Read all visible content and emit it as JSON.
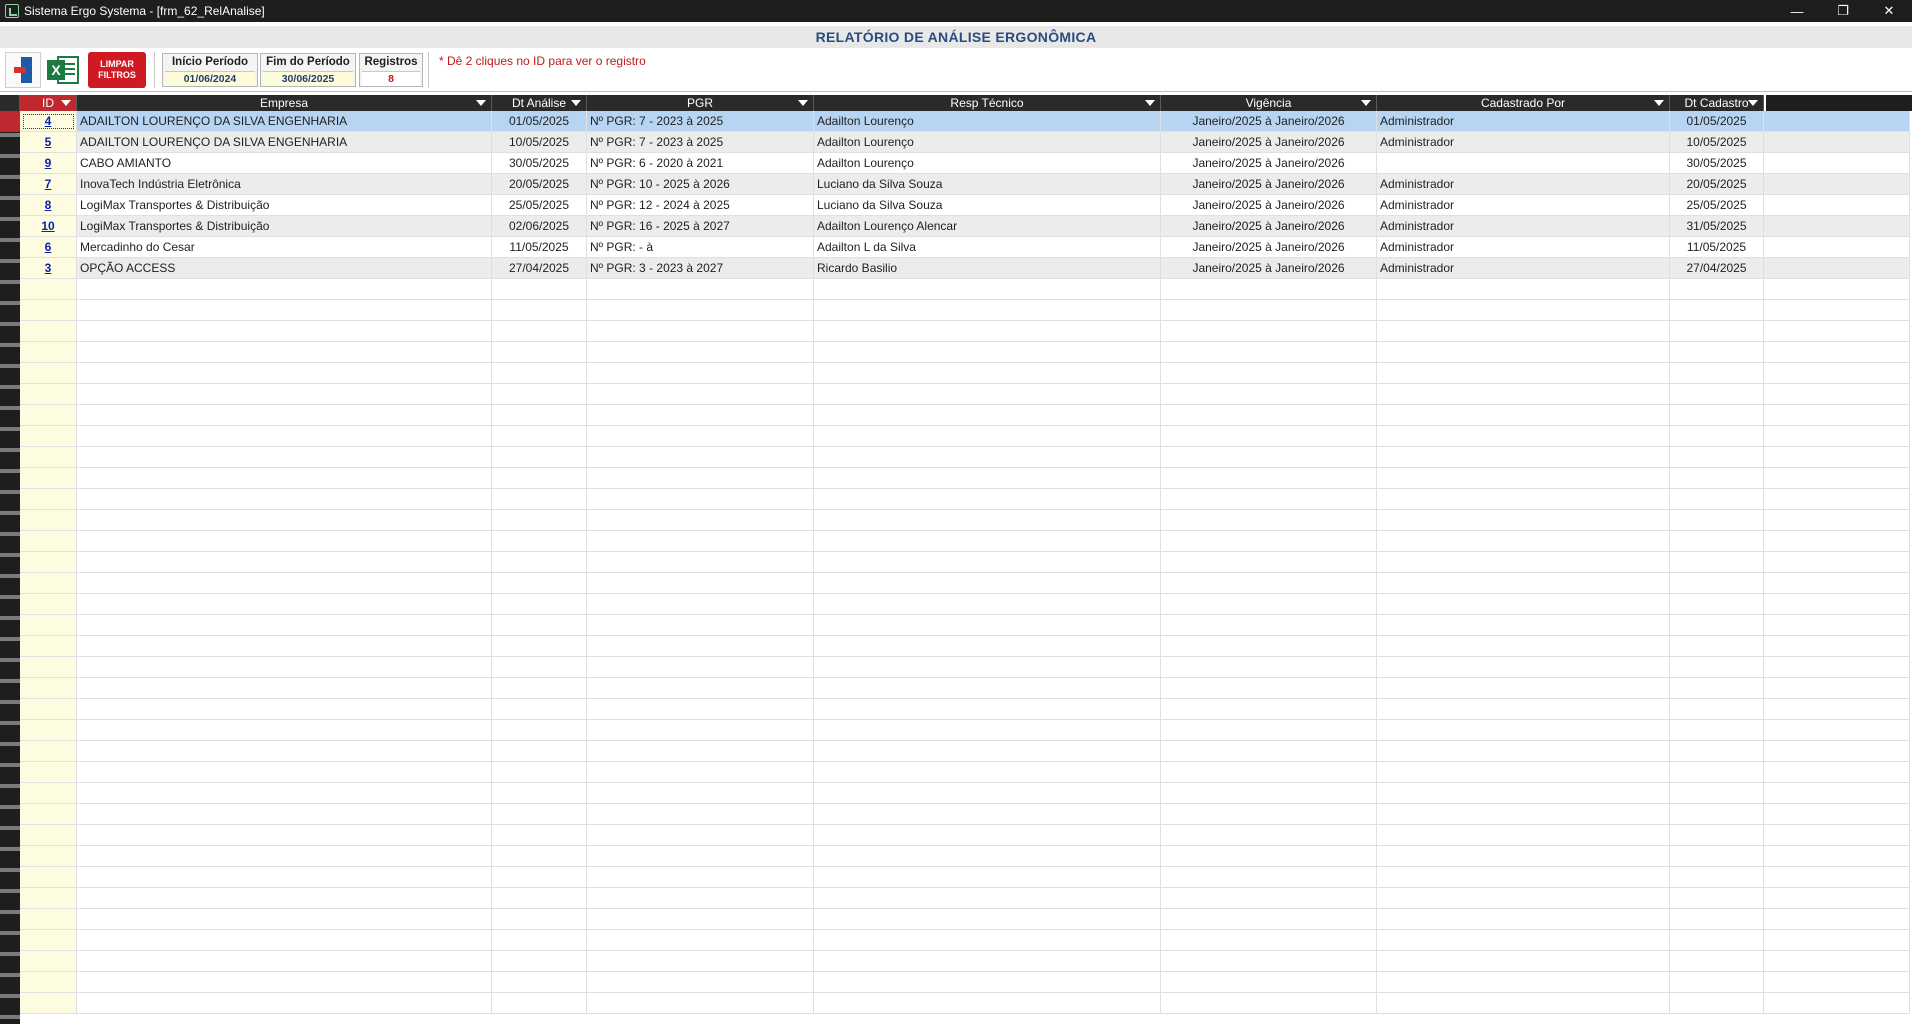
{
  "window": {
    "title": "Sistema Ergo Systema - [frm_62_RelAnalise]",
    "minimize": "—",
    "restore": "❐",
    "close": "✕"
  },
  "form": {
    "title": "RELATÓRIO DE ANÁLISE ERGONÔMICA"
  },
  "toolbar": {
    "excel_badge": "X",
    "clear_line1": "LIMPAR",
    "clear_line2": "FILTROS",
    "start_label": "Início Período",
    "start_value": "01/06/2024",
    "end_label": "Fim do Período",
    "end_value": "30/06/2025",
    "count_label": "Registros",
    "count_value": "8",
    "hint": "* Dê 2 cliques no ID para ver o registro"
  },
  "table": {
    "columns": [
      "ID",
      "Empresa",
      "Dt Análise",
      "PGR",
      "Resp Técnico",
      "Vigência",
      "Cadastrado Por",
      "Dt Cadastro"
    ],
    "rows": [
      {
        "id": "4",
        "empresa": "ADAILTON LOURENÇO DA SILVA ENGENHARIA",
        "dt_analise": "01/05/2025",
        "pgr": "Nº PGR: 7 - 2023 à 2025",
        "resp": "Adailton Lourenço",
        "vigencia": "Janeiro/2025 à Janeiro/2026",
        "cadastrado_por": "Administrador",
        "dt_cadastro": "01/05/2025"
      },
      {
        "id": "5",
        "empresa": "ADAILTON LOURENÇO DA SILVA ENGENHARIA",
        "dt_analise": "10/05/2025",
        "pgr": "Nº PGR: 7 - 2023 à 2025",
        "resp": "Adailton Lourenço",
        "vigencia": "Janeiro/2025 à Janeiro/2026",
        "cadastrado_por": "Administrador",
        "dt_cadastro": "10/05/2025"
      },
      {
        "id": "9",
        "empresa": "CABO AMIANTO",
        "dt_analise": "30/05/2025",
        "pgr": "Nº PGR: 6 - 2020 à 2021",
        "resp": "Adailton Lourenço",
        "vigencia": "Janeiro/2025 à Janeiro/2026",
        "cadastrado_por": "",
        "dt_cadastro": "30/05/2025"
      },
      {
        "id": "7",
        "empresa": "InovaTech Indústria Eletrônica",
        "dt_analise": "20/05/2025",
        "pgr": "Nº PGR: 10 - 2025 à 2026",
        "resp": "Luciano da Silva Souza",
        "vigencia": "Janeiro/2025 à Janeiro/2026",
        "cadastrado_por": "Administrador",
        "dt_cadastro": "20/05/2025"
      },
      {
        "id": "8",
        "empresa": "LogiMax Transportes & Distribuição",
        "dt_analise": "25/05/2025",
        "pgr": "Nº PGR: 12 - 2024 à 2025",
        "resp": "Luciano da Silva Souza",
        "vigencia": "Janeiro/2025 à Janeiro/2026",
        "cadastrado_por": "Administrador",
        "dt_cadastro": "25/05/2025"
      },
      {
        "id": "10",
        "empresa": "LogiMax Transportes & Distribuição",
        "dt_analise": "02/06/2025",
        "pgr": "Nº PGR: 16 - 2025 à 2027",
        "resp": "Adailton Lourenço Alencar",
        "vigencia": "Janeiro/2025 à Janeiro/2026",
        "cadastrado_por": "Administrador",
        "dt_cadastro": "31/05/2025"
      },
      {
        "id": "6",
        "empresa": "Mercadinho do Cesar",
        "dt_analise": "11/05/2025",
        "pgr": "Nº PGR:  - à",
        "resp": "Adailton L da Silva",
        "vigencia": "Janeiro/2025 à Janeiro/2026",
        "cadastrado_por": "Administrador",
        "dt_cadastro": "11/05/2025"
      },
      {
        "id": "3",
        "empresa": "OPÇÃO ACCESS",
        "dt_analise": "27/04/2025",
        "pgr": "Nº PGR: 3 - 2023 à 2027",
        "resp": "Ricardo Basilio",
        "vigencia": "Janeiro/2025 à Janeiro/2026",
        "cadastrado_por": "Administrador",
        "dt_cadastro": "27/04/2025"
      }
    ]
  },
  "colors": {
    "accent_red": "#c0282f",
    "title_blue": "#2b4c7e",
    "selection_blue": "#b7d5f3",
    "id_cell_yellow": "#fdfce0"
  }
}
